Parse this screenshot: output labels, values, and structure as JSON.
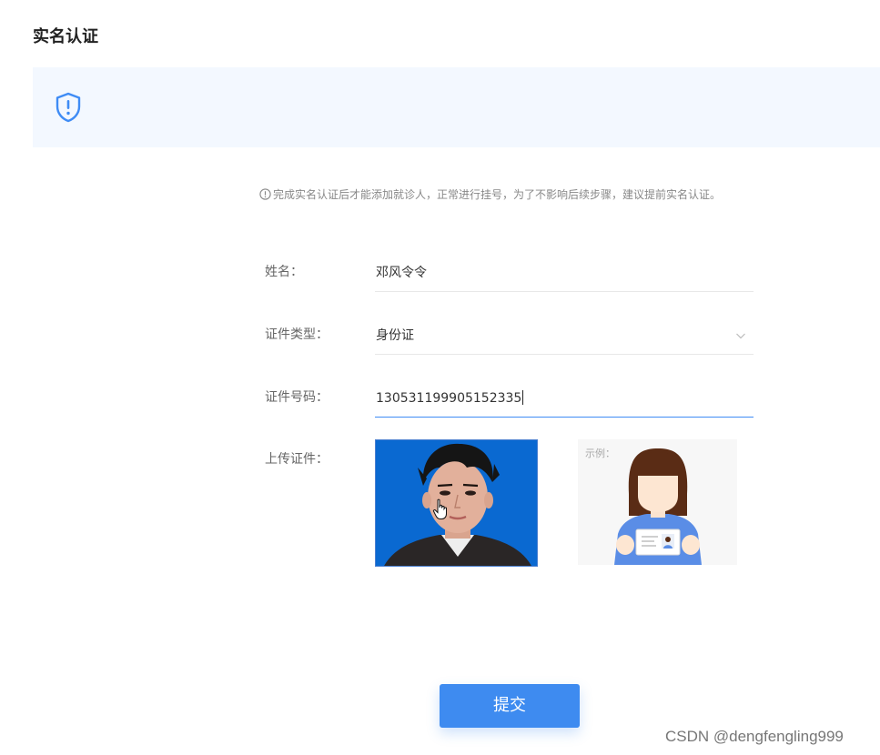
{
  "page": {
    "title": "实名认证"
  },
  "banner": {
    "icon": "shield-exclamation-icon",
    "accent_color": "#3f8cf5"
  },
  "notice": {
    "icon": "info-circle-icon",
    "text": "完成实名认证后才能添加就诊人，正常进行挂号，为了不影响后续步骤，建议提前实名认证。"
  },
  "form": {
    "name": {
      "label": "姓名：",
      "value": "邓风令令"
    },
    "id_type": {
      "label": "证件类型：",
      "value": "身份证",
      "icon": "chevron-down-icon"
    },
    "id_number": {
      "label": "证件号码：",
      "value": "130531199905152335"
    },
    "upload": {
      "label": "上传证件："
    },
    "example": {
      "label": "示例："
    }
  },
  "submit": {
    "label": "提交",
    "color": "#3e8bf0"
  },
  "watermark": {
    "text": "CSDN @dengfengling999"
  }
}
